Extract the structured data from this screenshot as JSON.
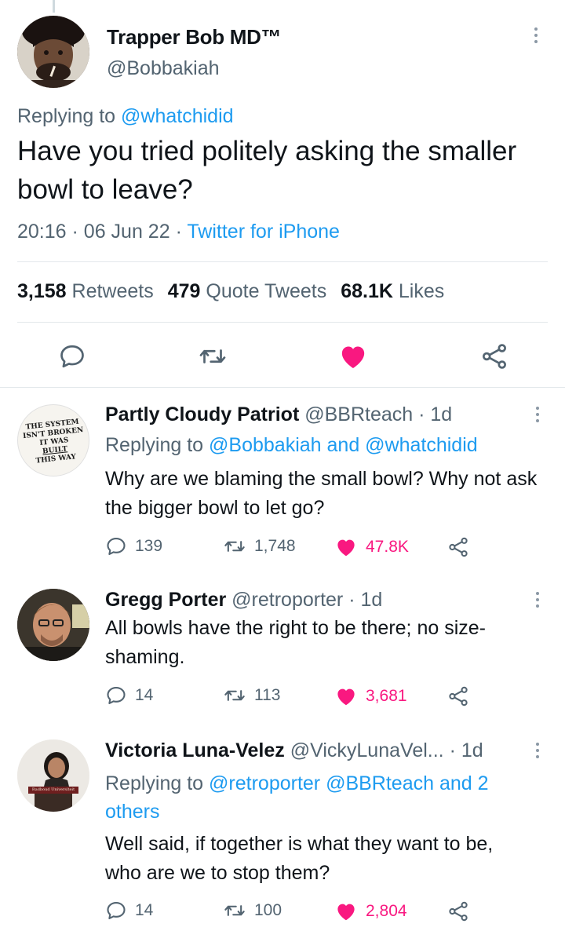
{
  "main_tweet": {
    "display_name": "Trapper Bob MD™",
    "handle": "@Bobbakiah",
    "replying_prefix": "Replying to ",
    "replying_to": "@whatchidid",
    "text": "Have you tried politely asking the smaller bowl to leave?",
    "time": "20:16",
    "date": "06 Jun 22",
    "source": "Twitter for iPhone",
    "stats": {
      "retweets_count": "3,158",
      "retweets_label": "Retweets",
      "quotes_count": "479",
      "quotes_label": "Quote Tweets",
      "likes_count": "68.1K",
      "likes_label": "Likes"
    }
  },
  "replies": [
    {
      "display_name": "Partly Cloudy Patriot",
      "handle": "@BBRteach",
      "time": "1d",
      "avatar_sign": [
        "THE SYSTEM",
        "ISN'T BROKEN",
        "IT WAS",
        "BUILT",
        "THIS WAY"
      ],
      "replying_prefix": "Replying to ",
      "replying_mentions": "@Bobbakiah and @whatchidid",
      "text": "Why are we blaming the small bowl? Why not ask the bigger bowl to let go?",
      "replies_count": "139",
      "retweets_count": "1,748",
      "likes_count": "47.8K"
    },
    {
      "display_name": "Gregg Porter",
      "handle": "@retroporter",
      "time": "1d",
      "text": "All bowls have the right to be there; no size-shaming.",
      "replies_count": "14",
      "retweets_count": "113",
      "likes_count": "3,681"
    },
    {
      "display_name": "Victoria Luna-Velez",
      "handle": "@VickyLunaVel...",
      "time": "1d",
      "avatar_banner": "Radboud Universiteit",
      "replying_prefix": "Replying to ",
      "replying_mentions": "@retroporter @BBRteach and 2 others",
      "text": "Well said, if together is what they want to be, who are we to stop them?",
      "replies_count": "14",
      "retweets_count": "100",
      "likes_count": "2,804"
    }
  ],
  "icons": {
    "reply": "reply-icon",
    "retweet": "retweet-icon",
    "like": "heart-icon",
    "share": "share-icon",
    "more": "more-icon"
  },
  "colors": {
    "accent": "#1d9bf0",
    "like": "#f91880",
    "secondary_text": "#536471",
    "primary_text": "#0f1419"
  }
}
